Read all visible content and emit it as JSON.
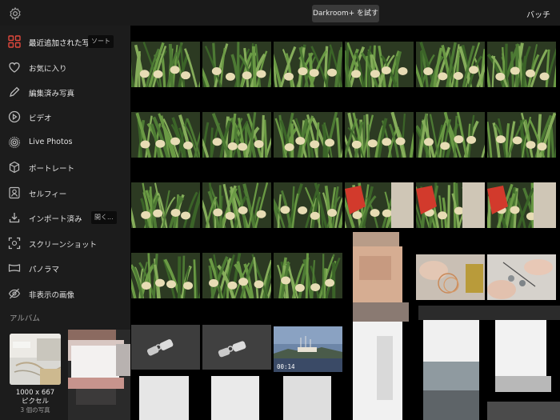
{
  "topbar": {
    "try_label": "Darkroom+ を試す",
    "batch_label": "バッチ"
  },
  "sidebar": {
    "items": [
      {
        "label": "最近追加された写真",
        "icon": "grid-icon",
        "active": true
      },
      {
        "label": "お気に入り",
        "icon": "heart-icon"
      },
      {
        "label": "編集済み写真",
        "icon": "pencil-icon"
      },
      {
        "label": "ビデオ",
        "icon": "play-icon"
      },
      {
        "label": "Live Photos",
        "icon": "live-photo-icon"
      },
      {
        "label": "ポートレート",
        "icon": "cube-icon"
      },
      {
        "label": "セルフィー",
        "icon": "selfie-icon"
      },
      {
        "label": "インポート済み",
        "icon": "import-icon"
      },
      {
        "label": "スクリーンショット",
        "icon": "screenshot-icon"
      },
      {
        "label": "パノラマ",
        "icon": "panorama-icon"
      },
      {
        "label": "非表示の画像",
        "icon": "hidden-icon"
      }
    ],
    "sort_chip": "ソート",
    "open_chip": "開く...",
    "albums_heading": "アルバム",
    "album": {
      "dims": "1000 x 667",
      "unit": "ピクセル",
      "count": "3 個の写真"
    }
  },
  "grid": {
    "video_duration": "00:14"
  },
  "colors": {
    "accent": "#e0483c",
    "sidebar_bg": "#1c1c1c",
    "topbar_bg": "#1a1a1a"
  }
}
